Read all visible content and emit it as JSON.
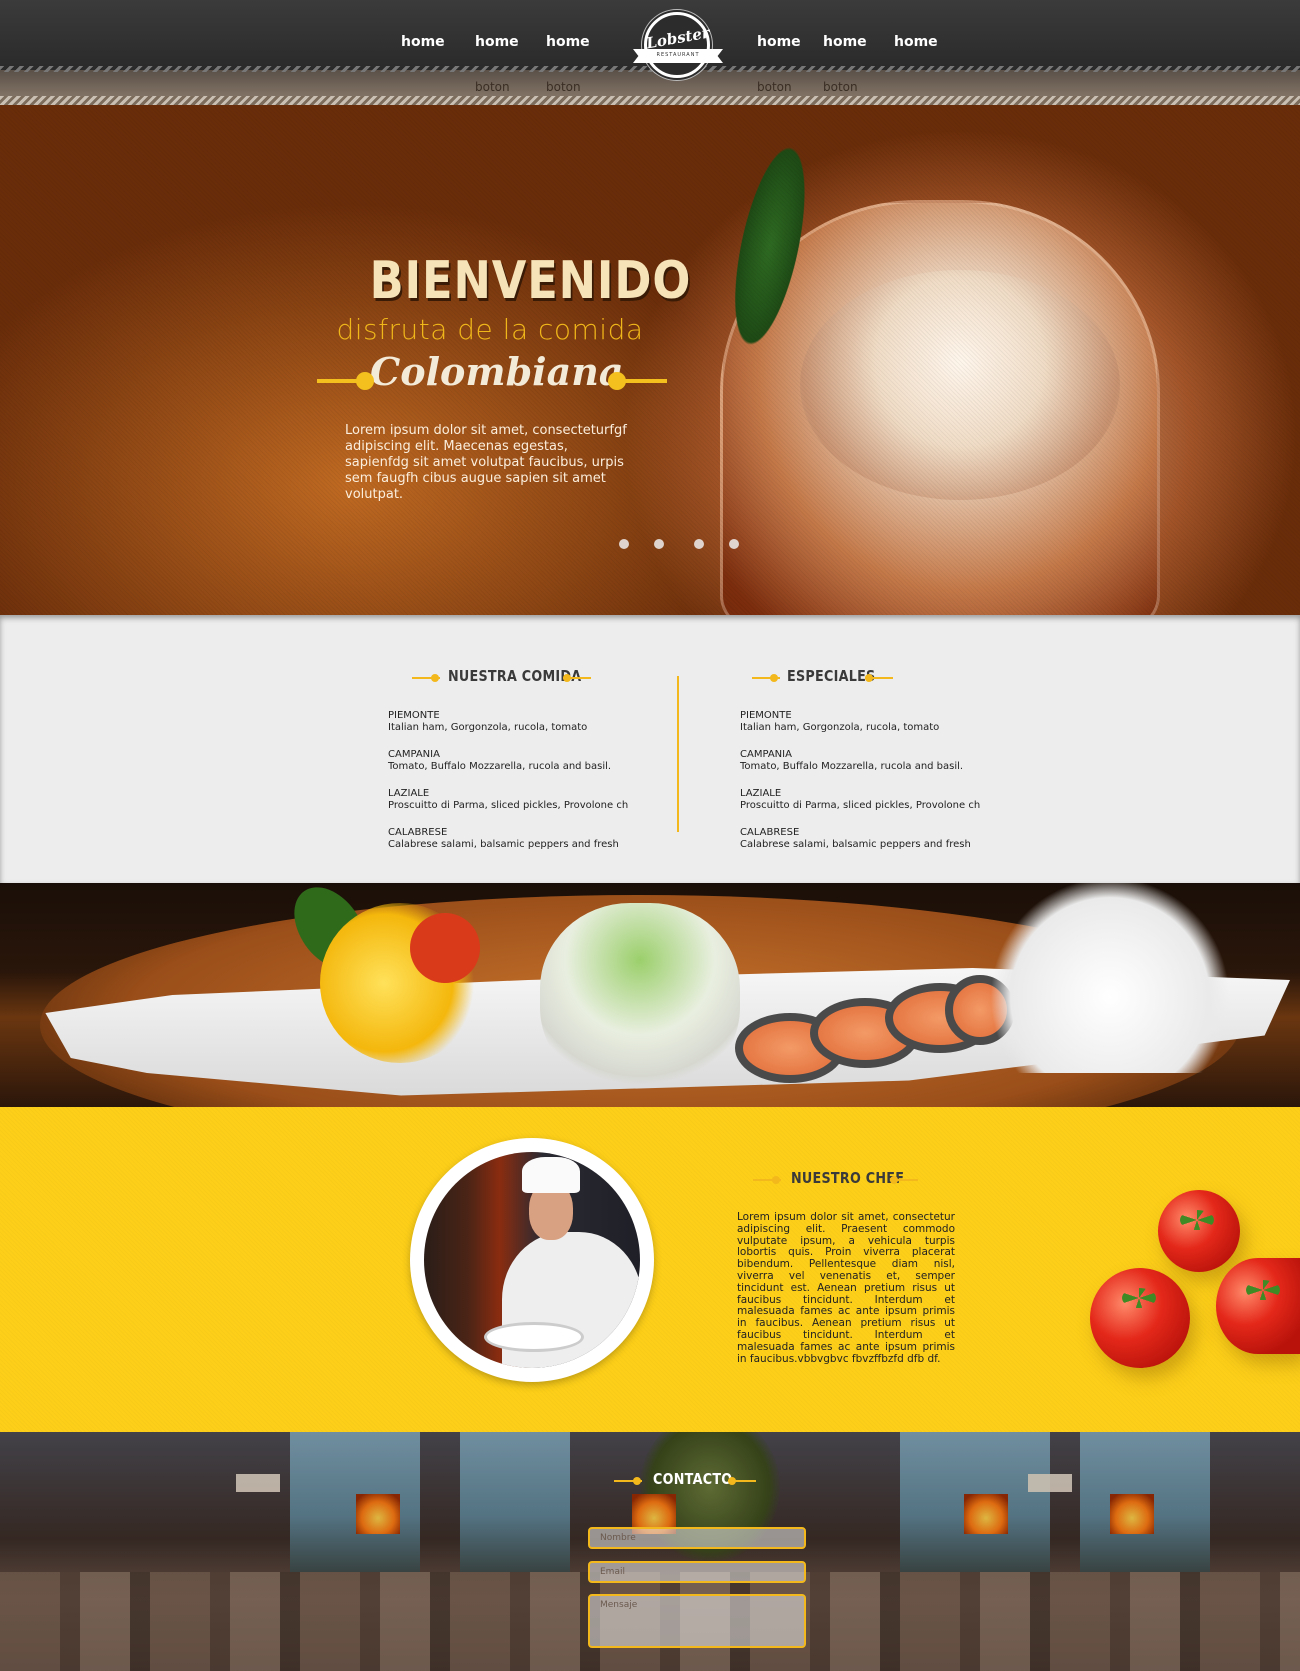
{
  "header": {
    "logo_text": "Lobster",
    "logo_subtext": "RESTAURANT",
    "nav_left": [
      "home",
      "home",
      "home"
    ],
    "nav_right": [
      "home",
      "home",
      "home"
    ],
    "sub_left": [
      "boton",
      "boton"
    ],
    "sub_right": [
      "boton",
      "boton"
    ]
  },
  "hero": {
    "title": "BIENVENIDO",
    "subtitle": "disfruta de la comida",
    "script": "Colombiana",
    "body": "Lorem ipsum dolor sit amet, consecteturfgf adipiscing elit. Maecenas egestas, sapienfdg sit amet volutpat faucibus, urpis sem faugfh cibus augue sapien sit amet volutpat.",
    "slides": 4
  },
  "menu": {
    "left_heading": "NUESTRA COMIDA",
    "right_heading": "ESPECIALES",
    "left_items": [
      {
        "name": "PIEMONTE",
        "desc": "Italian ham, Gorgonzola, rucola, tomato"
      },
      {
        "name": "CAMPANIA",
        "desc": "Tomato, Buffalo Mozzarella, rucola and basil."
      },
      {
        "name": "LAZIALE",
        "desc": "Proscuitto di Parma, sliced pickles, Provolone ch"
      },
      {
        "name": "CALABRESE",
        "desc": "Calabrese salami, balsamic peppers and fresh"
      }
    ],
    "right_items": [
      {
        "name": "PIEMONTE",
        "desc": "Italian ham, Gorgonzola, rucola, tomato"
      },
      {
        "name": "CAMPANIA",
        "desc": "Tomato, Buffalo Mozzarella, rucola and basil."
      },
      {
        "name": "LAZIALE",
        "desc": "Proscuitto di Parma, sliced pickles, Provolone ch"
      },
      {
        "name": "CALABRESE",
        "desc": "Calabrese salami, balsamic peppers and fresh"
      }
    ]
  },
  "chef": {
    "heading": "NUESTRO CHEF",
    "body": "Lorem ipsum dolor sit amet, consectetur adipiscing elit. Praesent commodo vulputate ipsum, a vehicula turpis lobortis quis. Proin viverra placerat bibendum. Pellentesque diam nisl, viverra vel venenatis et, semper tincidunt est. Aenean pretium risus ut faucibus tincidunt. Interdum et malesuada fames ac ante ipsum primis in faucibus. Aenean pretium risus ut faucibus tincidunt. Interdum et malesuada fames ac ante ipsum primis in faucibus.vbbvgbvc fbvzffbzfd dfb df."
  },
  "contact": {
    "heading": "CONTACTO",
    "name_placeholder": "Nombre",
    "email_placeholder": "Email",
    "message_placeholder": "Mensaje"
  },
  "colors": {
    "accent": "#f2b81c",
    "chef_bg": "#fdcf19",
    "menu_bg": "#ededed",
    "header_bg": "#2f2f2f"
  }
}
